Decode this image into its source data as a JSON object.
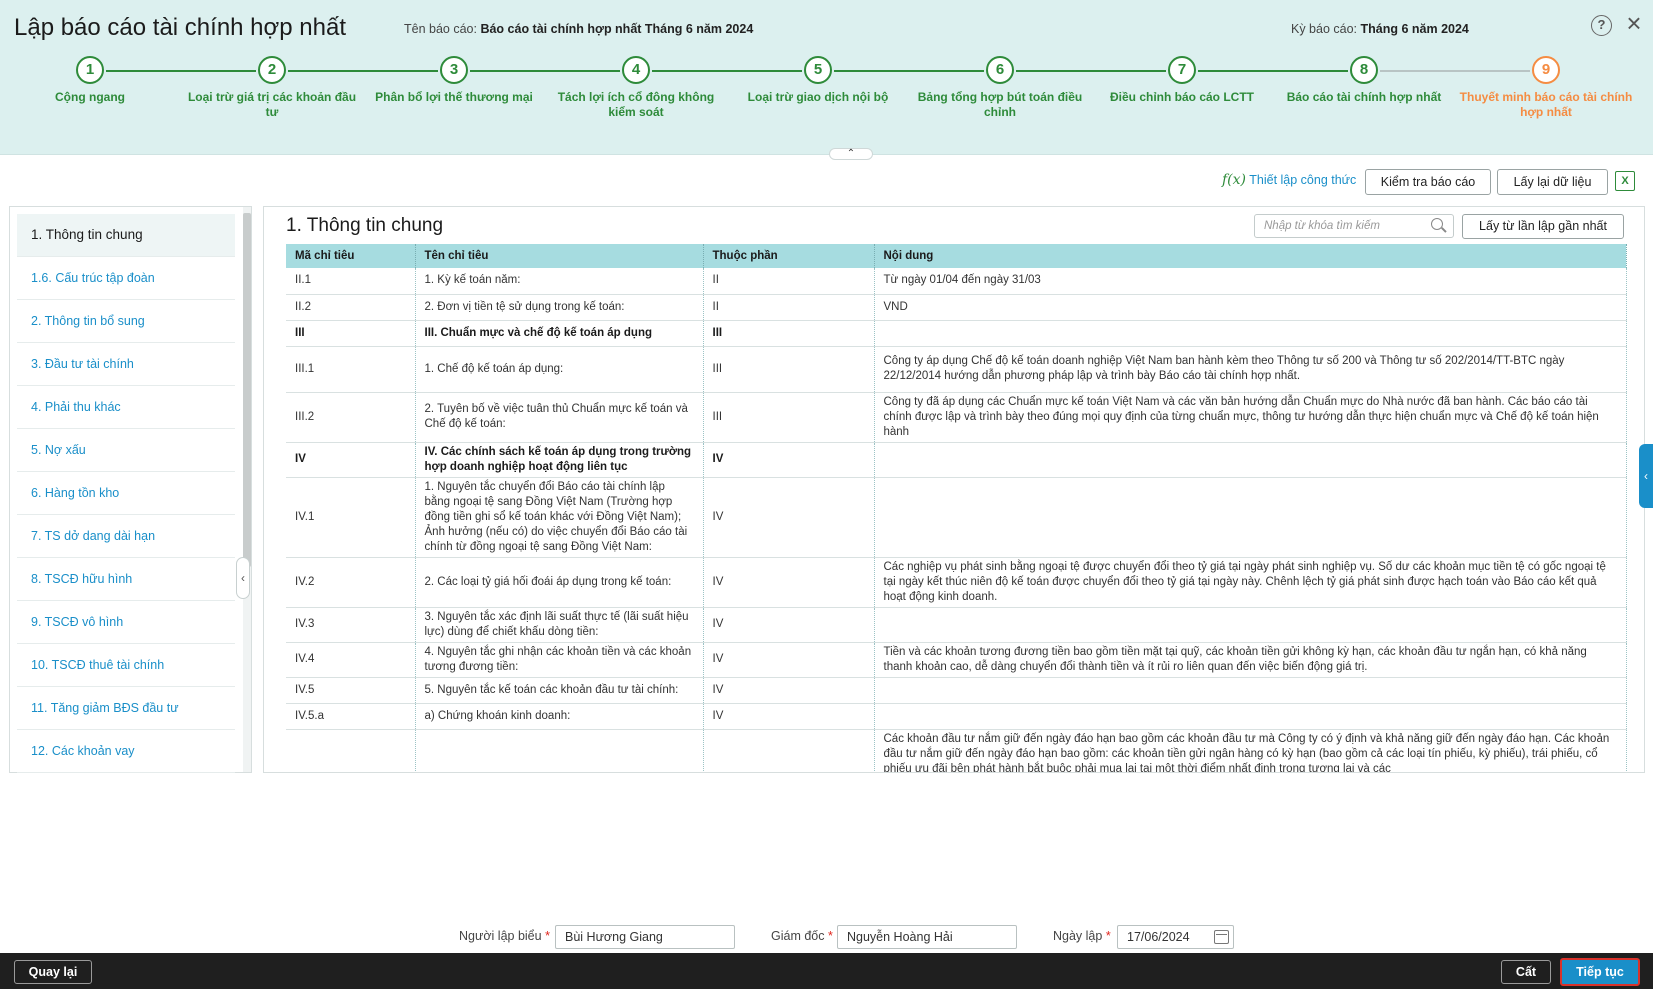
{
  "header": {
    "title": "Lập báo cáo tài chính hợp nhất",
    "report_name_label": "Tên báo cáo:",
    "report_name": "Báo cáo tài chính hợp nhất Tháng 6 năm 2024",
    "period_label": "Kỳ báo cáo:",
    "period": "Tháng 6 năm 2024",
    "help_icon": "question-circle-icon",
    "close_icon": "close-icon"
  },
  "steps": [
    {
      "num": "1",
      "label": "Cộng ngang",
      "state": "done"
    },
    {
      "num": "2",
      "label": "Loại trừ giá trị các khoản đầu tư",
      "state": "done"
    },
    {
      "num": "3",
      "label": "Phân bổ lợi thế thương mại",
      "state": "done"
    },
    {
      "num": "4",
      "label": "Tách lợi ích cổ đông không kiểm soát",
      "state": "done"
    },
    {
      "num": "5",
      "label": "Loại trừ giao dịch nội bộ",
      "state": "done"
    },
    {
      "num": "6",
      "label": "Bảng tổng hợp bút toán điều chỉnh",
      "state": "done"
    },
    {
      "num": "7",
      "label": "Điều chỉnh báo cáo LCTT",
      "state": "done"
    },
    {
      "num": "8",
      "label": "Báo cáo tài chính hợp nhất",
      "state": "done"
    },
    {
      "num": "9",
      "label": "Thuyết minh báo cáo tài chính hợp nhất",
      "state": "active"
    }
  ],
  "toolbar": {
    "formula_icon": "f(x)",
    "formula_label": "Thiết lập công thức",
    "check_label": "Kiểm tra báo cáo",
    "reload_label": "Lấy lại dữ liệu",
    "excel_icon": "X"
  },
  "sidebar": {
    "items": [
      {
        "label": "1. Thông tin chung",
        "active": true
      },
      {
        "label": "1.6. Cấu trúc tập đoàn"
      },
      {
        "label": "2. Thông tin bổ sung"
      },
      {
        "label": "3. Đầu tư tài chính"
      },
      {
        "label": "4. Phải thu khác"
      },
      {
        "label": "5. Nợ xấu"
      },
      {
        "label": "6. Hàng tồn kho"
      },
      {
        "label": "7. TS dở dang dài hạn"
      },
      {
        "label": "8. TSCĐ hữu hình"
      },
      {
        "label": "9. TSCĐ vô hình"
      },
      {
        "label": "10. TSCĐ thuê tài chính"
      },
      {
        "label": "11. Tăng giảm BĐS đầu tư"
      },
      {
        "label": "12. Các khoản vay"
      }
    ]
  },
  "main": {
    "section_title": "1. Thông tin chung",
    "search_placeholder": "Nhập từ khóa tìm kiếm",
    "latest_button": "Lấy từ lần lập gần nhất",
    "columns": [
      "Mã chỉ tiêu",
      "Tên chỉ tiêu",
      "Thuộc phần",
      "Nội dung"
    ],
    "rows": [
      {
        "code": "II.1",
        "name": "1. Kỳ kế toán năm:",
        "part": "II",
        "content": "Từ ngày 01/04 đến ngày 31/03",
        "bold": false
      },
      {
        "code": "II.2",
        "name": "2. Đơn vị tiền tệ sử dụng trong kế toán:",
        "part": "II",
        "content": "VND",
        "bold": false
      },
      {
        "code": "III",
        "name": "III. Chuẩn mực và chế độ kế toán áp dụng",
        "part": "III",
        "content": "",
        "bold": true
      },
      {
        "code": "III.1",
        "name": "1. Chế độ kế toán áp dụng:",
        "part": "III",
        "content": "Công ty áp dụng Chế độ kế toán doanh nghiệp Việt Nam ban hành kèm theo Thông tư số 200 và Thông tư số 202/2014/TT-BTC ngày 22/12/2014 hướng dẫn phương pháp lập và trình bày Báo cáo tài chính hợp nhất.",
        "bold": false
      },
      {
        "code": "III.2",
        "name": "2. Tuyên bố về việc tuân thủ Chuẩn mực kế toán và Chế độ kế toán:",
        "part": "III",
        "content": "Công ty đã áp dụng các Chuẩn mực kế toán Việt Nam và các văn bản hướng dẫn Chuẩn mực do Nhà nước đã ban hành. Các báo cáo tài chính được lập và trình bày theo đúng mọi quy định của từng chuẩn mực, thông tư hướng dẫn thực hiện chuẩn mực và Chế độ kế toán hiện hành",
        "bold": false
      },
      {
        "code": "IV",
        "name": "IV. Các chính sách kế toán áp dụng trong trường hợp doanh nghiệp hoạt động liên tục",
        "part": "IV",
        "content": "",
        "bold": true
      },
      {
        "code": "IV.1",
        "name": "1. Nguyên tắc chuyển đổi Báo cáo tài chính lập bằng ngoại tệ sang Đồng Việt Nam (Trường hợp đồng tiền ghi sổ kế toán khác với Đồng Việt Nam); Ảnh hưởng (nếu có) do việc chuyển đổi Báo cáo tài chính từ đồng ngoại tệ sang Đồng Việt Nam:",
        "part": "IV",
        "content": "",
        "bold": false
      },
      {
        "code": "IV.2",
        "name": "2. Các loại tỷ giá hối đoái áp dụng trong kế toán:",
        "part": "IV",
        "content": "Các nghiệp vụ phát sinh bằng ngoại tệ được chuyển đổi theo tỷ giá tại ngày phát sinh nghiệp vụ. Số dư các khoản mục tiền tệ có gốc ngoại tệ tại ngày kết thúc niên độ kế toán được chuyển đổi theo tỷ giá tại ngày này. Chênh lệch tỷ giá phát sinh được hạch toán vào Báo cáo kết quả hoạt động kinh doanh.",
        "bold": false
      },
      {
        "code": "IV.3",
        "name": "3. Nguyên tắc xác định lãi suất thực tế (lãi suất hiệu lực) dùng để chiết khấu dòng tiền:",
        "part": "IV",
        "content": "",
        "bold": false
      },
      {
        "code": "IV.4",
        "name": "4. Nguyên tắc ghi nhận các khoản tiền và các khoản tương đương tiền:",
        "part": "IV",
        "content": "Tiền và các khoản tương đương tiền bao gồm tiền mặt tại quỹ, các khoản tiền gửi không kỳ hạn, các khoản đầu tư ngắn hạn, có khả năng thanh khoản cao, dễ dàng chuyển đổi thành tiền và ít rủi ro liên quan đến việc biến động giá trị.",
        "bold": false
      },
      {
        "code": "IV.5",
        "name": "5. Nguyên tắc kế toán các khoản đầu tư tài chính:",
        "part": "IV",
        "content": "",
        "bold": false
      },
      {
        "code": "IV.5.a",
        "name": "a) Chứng khoán kinh doanh:",
        "part": "IV",
        "content": "",
        "bold": false
      },
      {
        "code": "",
        "name": "",
        "part": "",
        "content": "Các khoản đầu tư nắm giữ đến ngày đáo hạn bao gồm các khoản đầu tư mà Công ty có ý định và khả năng giữ đến ngày đáo hạn. Các khoản đầu tư nắm giữ đến ngày đáo hạn bao gồm: các khoản tiền gửi ngân hàng có kỳ hạn (bao gồm cả các loại tín phiếu, kỳ phiếu), trái phiếu, cổ phiếu ưu đãi bên phát hành bắt buộc phải mua lại tại một thời điểm nhất định trong tương lai và các",
        "bold": false
      }
    ]
  },
  "signatures": {
    "preparer_label": "Người lập biểu",
    "preparer": "Bùi Hương Giang",
    "director_label": "Giám đốc",
    "director": "Nguyễn Hoàng Hải",
    "date_label": "Ngày lập",
    "date": "17/06/2024",
    "required_mark": "*"
  },
  "footer": {
    "back_label": "Quay lại",
    "save_label": "Cất",
    "next_label": "Tiếp tục"
  },
  "colors": {
    "done_step": "#2e8b3a",
    "active_step": "#f58c42",
    "header_bg": "#dcf0ef",
    "table_header_bg": "#a6dce0",
    "link": "#1a8fc9",
    "primary": "#1a8fc9",
    "footer_bg": "#1f1f1f"
  }
}
